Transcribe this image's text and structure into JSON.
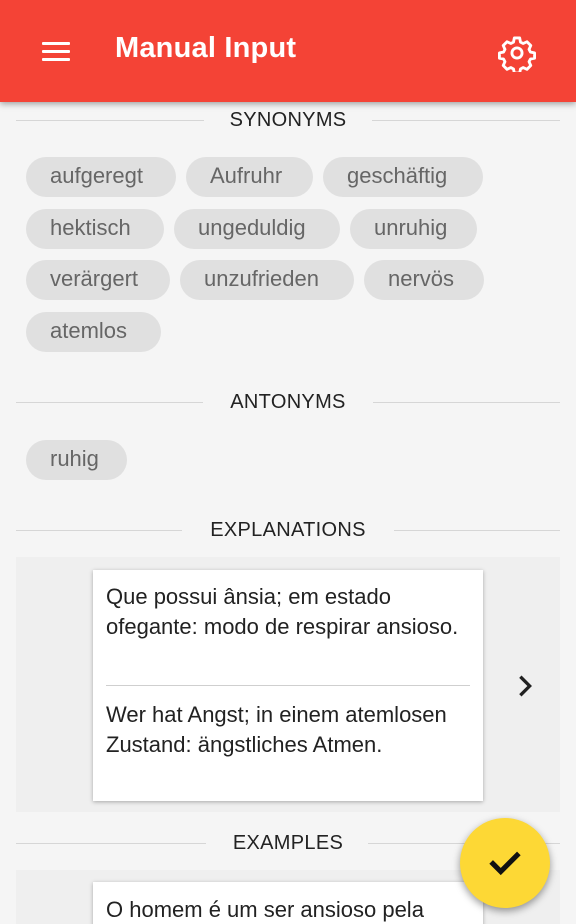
{
  "appbar": {
    "title": "Manual Input",
    "menu_icon": "menu-icon",
    "settings_icon": "gear-icon",
    "color": "#f44336"
  },
  "synonyms": {
    "header": "SYNONYMS",
    "items": [
      "aufgeregt",
      "Aufruhr",
      "geschäftig",
      "hektisch",
      "ungeduldig",
      "unruhig",
      "verärgert",
      "unzufrieden",
      "nervös",
      "atemlos"
    ]
  },
  "antonyms": {
    "header": "ANTONYMS",
    "items": [
      "ruhig"
    ]
  },
  "explanations": {
    "header": "EXPLANATIONS",
    "card": {
      "text_pt": "Que possui ânsia; em estado ofegante: modo de respirar ansioso.",
      "text_de": "Wer hat Angst; in einem atemlosen Zustand: ängstliches Atmen."
    },
    "next_icon": "chevron-right-icon"
  },
  "examples": {
    "header": "EXAMPLES",
    "card": {
      "text": "O homem é um ser ansioso pela"
    }
  },
  "fab": {
    "icon": "checkmark-icon",
    "color": "#fdd835"
  }
}
